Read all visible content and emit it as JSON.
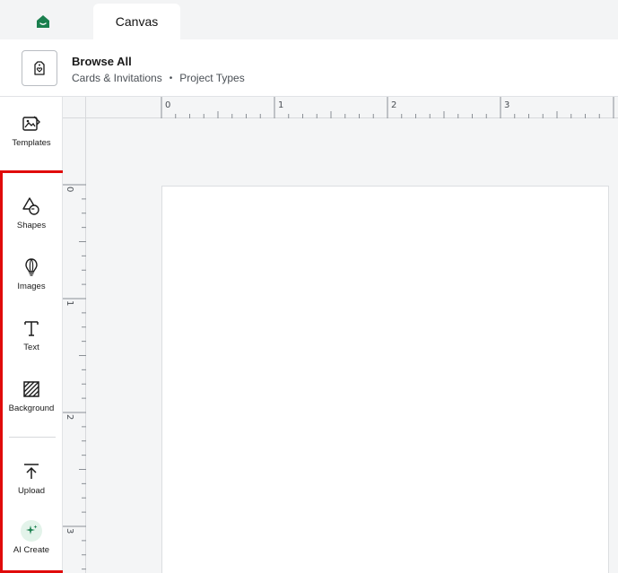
{
  "topbar": {
    "home_icon": "home-icon",
    "canvas_tab_label": "Canvas"
  },
  "subheader": {
    "project_icon": "card-tag-icon",
    "title": "Browse All",
    "breadcrumbs": [
      "Cards & Invitations",
      "Project Types"
    ],
    "separator": "•"
  },
  "sidebar": {
    "items": [
      {
        "label": "Templates",
        "icon": "templates-icon"
      },
      {
        "label": "Shapes",
        "icon": "shapes-icon"
      },
      {
        "label": "Images",
        "icon": "lightbulb-icon"
      },
      {
        "label": "Text",
        "icon": "text-icon"
      },
      {
        "label": "Background",
        "icon": "background-icon"
      },
      {
        "label": "Upload",
        "icon": "upload-icon"
      },
      {
        "label": "AI Create",
        "icon": "sparkle-icon"
      }
    ]
  },
  "rulers": {
    "horizontal_labels": [
      "0",
      "1",
      "2",
      "3"
    ],
    "vertical_labels": [
      "0",
      "1",
      "2",
      "3"
    ]
  },
  "colors": {
    "brand_green": "#1a7f4e",
    "highlight_red": "#e00b0b",
    "ai_badge_bg": "#e3f3ea"
  }
}
